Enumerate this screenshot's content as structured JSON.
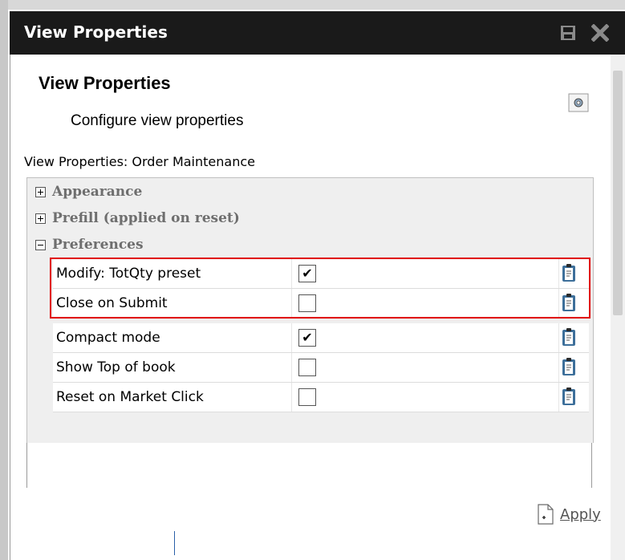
{
  "window": {
    "title": "View Properties",
    "colors": {
      "titlebar": "#1a1a1a",
      "highlight": "#e00000"
    }
  },
  "header": {
    "title": "View Properties",
    "subtitle": "Configure view properties"
  },
  "view_label": "View Properties: Order Maintenance",
  "groups": [
    {
      "label": "Appearance",
      "expanded": false
    },
    {
      "label": "Prefill (applied on reset)",
      "expanded": false
    },
    {
      "label": "Preferences",
      "expanded": true
    }
  ],
  "preferences": [
    {
      "label": "Modify: TotQty preset",
      "checked": true,
      "highlighted": true
    },
    {
      "label": "Close on Submit",
      "checked": false,
      "highlighted": true
    },
    {
      "label": "Compact mode",
      "checked": true,
      "highlighted": false
    },
    {
      "label": "Show Top of book",
      "checked": false,
      "highlighted": false
    },
    {
      "label": "Reset on Market Click",
      "checked": false,
      "highlighted": false
    }
  ],
  "footer": {
    "apply_label": "Apply"
  },
  "icons": {
    "titlebar_left": "save-icon",
    "titlebar_right": "close-icon",
    "settings": "gear-icon",
    "row_action": "clipboard-icon",
    "apply": "apply-icon"
  }
}
